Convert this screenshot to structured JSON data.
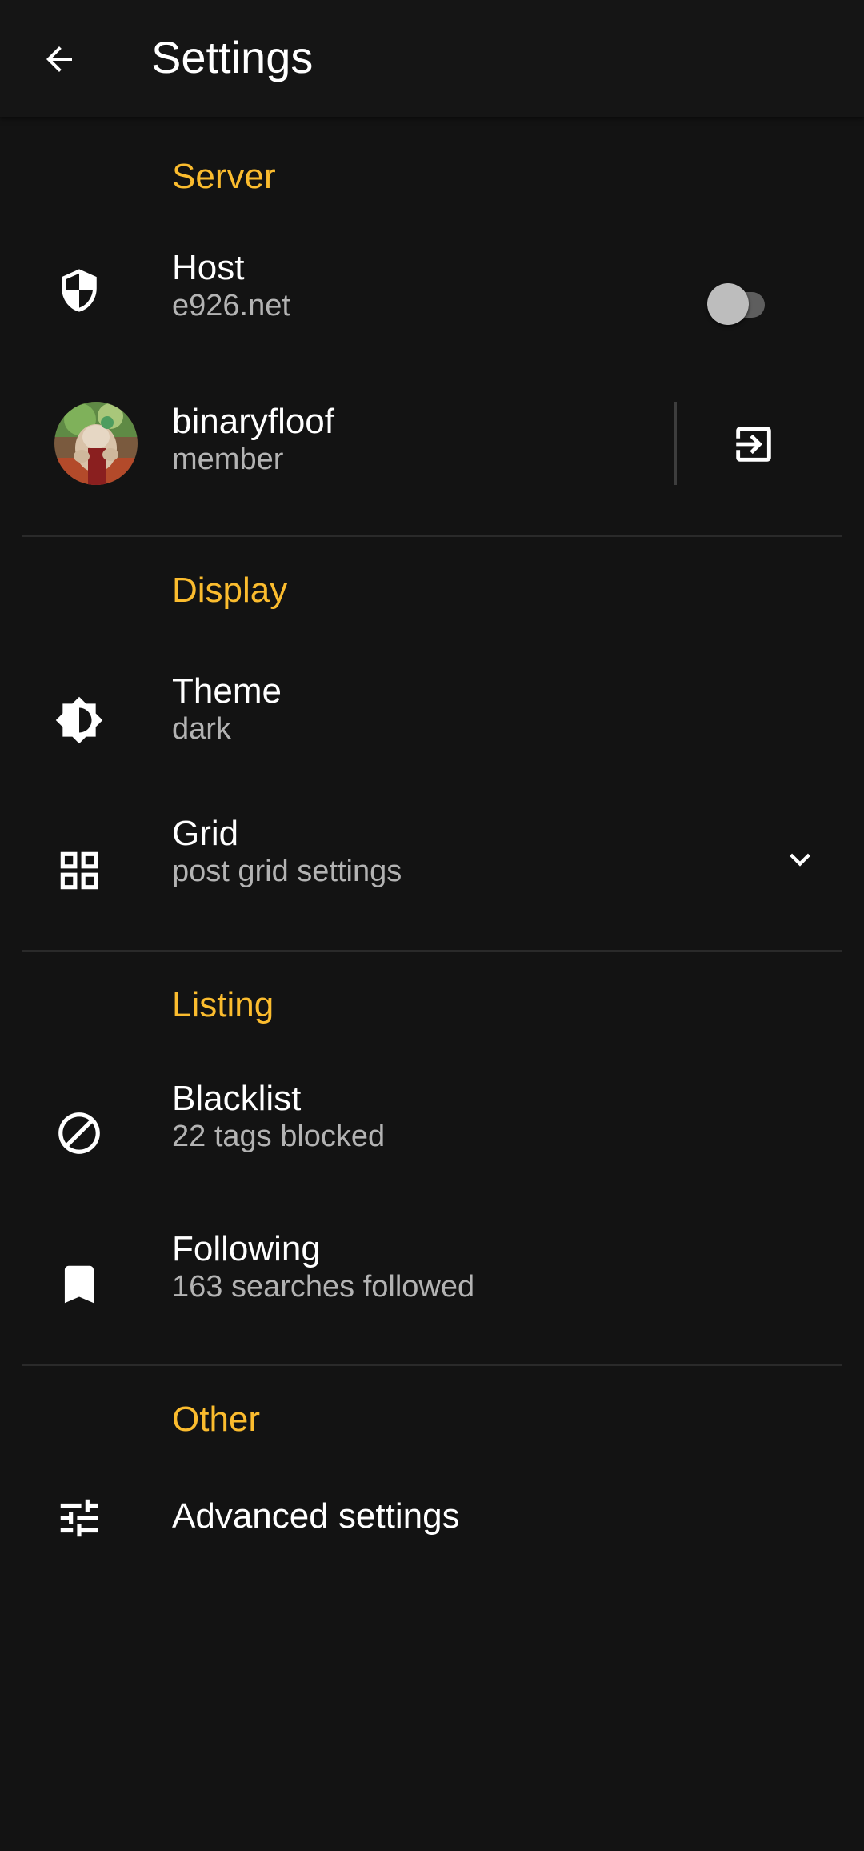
{
  "appbar": {
    "title": "Settings",
    "back_icon": "arrow-back-icon"
  },
  "colors": {
    "background": "#131313",
    "section_accent": "#fbbc2e",
    "subtitle": "#b3b3b3"
  },
  "sections": {
    "server": {
      "header": "Server",
      "host": {
        "title": "Host",
        "subtitle": "e926.net",
        "icon": "shield-icon",
        "toggle_on": false
      },
      "account": {
        "title": "binaryfloof",
        "subtitle": "member",
        "logout_icon": "logout-icon"
      }
    },
    "display": {
      "header": "Display",
      "theme": {
        "title": "Theme",
        "subtitle": "dark",
        "icon": "brightness-icon"
      },
      "grid": {
        "title": "Grid",
        "subtitle": "post grid settings",
        "icon": "grid-icon",
        "expand_icon": "chevron-down-icon"
      }
    },
    "listing": {
      "header": "Listing",
      "blacklist": {
        "title": "Blacklist",
        "subtitle": "22 tags blocked",
        "icon": "block-icon"
      },
      "following": {
        "title": "Following",
        "subtitle": "163 searches followed",
        "icon": "bookmark-icon"
      }
    },
    "other": {
      "header": "Other",
      "advanced": {
        "title": "Advanced settings",
        "icon": "tune-icon"
      }
    }
  }
}
